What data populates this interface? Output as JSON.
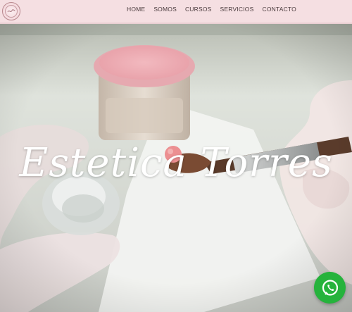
{
  "header": {
    "logo_icon": "brand-logo-icon",
    "nav": [
      {
        "label": "HOME"
      },
      {
        "label": "SOMOS"
      },
      {
        "label": "CURSOS"
      },
      {
        "label": "SERVICIOS"
      },
      {
        "label": "CONTACTO"
      }
    ]
  },
  "hero": {
    "title": "Estetica Torres"
  },
  "floating": {
    "whatsapp_icon": "whatsapp-icon"
  },
  "colors": {
    "header_bg": "#f5dfe2",
    "nav_text": "#4a3b3d",
    "title_text": "#ffffff",
    "whatsapp_green": "#25b33c"
  }
}
